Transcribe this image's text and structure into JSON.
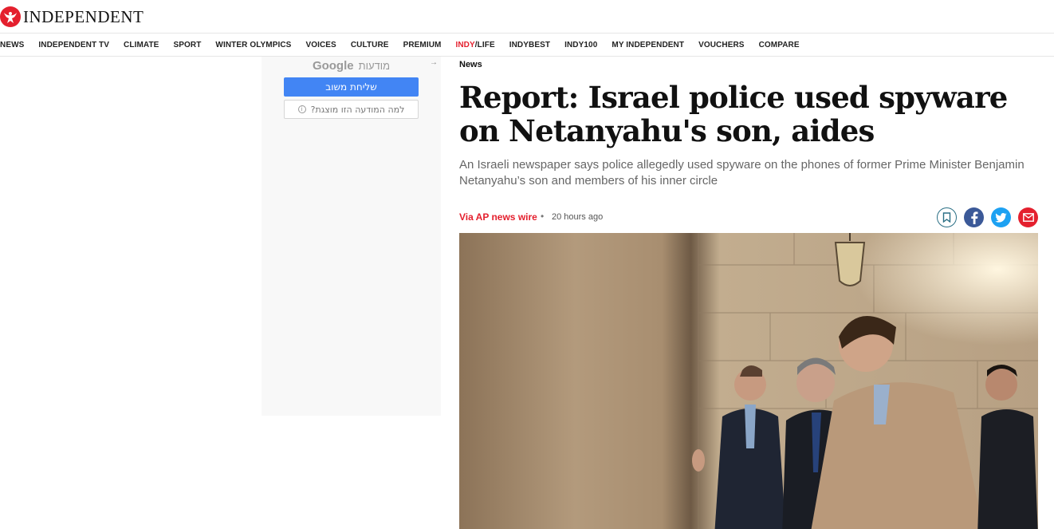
{
  "brand": {
    "name": "INDEPENDENT",
    "color": "#e4202e"
  },
  "nav": {
    "items": [
      "NEWS",
      "INDEPENDENT TV",
      "CLIMATE",
      "SPORT",
      "WINTER OLYMPICS",
      "VOICES",
      "CULTURE",
      "PREMIUM",
      "INDY/LIFE",
      "INDYBEST",
      "INDY100",
      "MY INDEPENDENT",
      "VOUCHERS",
      "COMPARE"
    ],
    "indy_prefix": "INDY",
    "indy_suffix": "/LIFE"
  },
  "ad": {
    "google_label": "Google",
    "ads_label": "מודעות",
    "send_feedback_label": "שליחת משוב",
    "why_this_ad_label": "?למה המודעה הזו מוצגת",
    "arrow": "→"
  },
  "article": {
    "section": "News",
    "headline": "Report: Israel police used spyware on Netanyahu's son, aides",
    "standfirst": "An Israeli newspaper says police allegedly used spyware on the phones of former Prime Minister Benjamin Netanyahu’s son and members of his inner circle",
    "byline": "Via AP news wire",
    "separator": "•",
    "timestamp": "20 hours ago"
  },
  "share": {
    "icons": [
      "bookmark-icon",
      "facebook-icon",
      "twitter-icon",
      "email-icon"
    ]
  }
}
